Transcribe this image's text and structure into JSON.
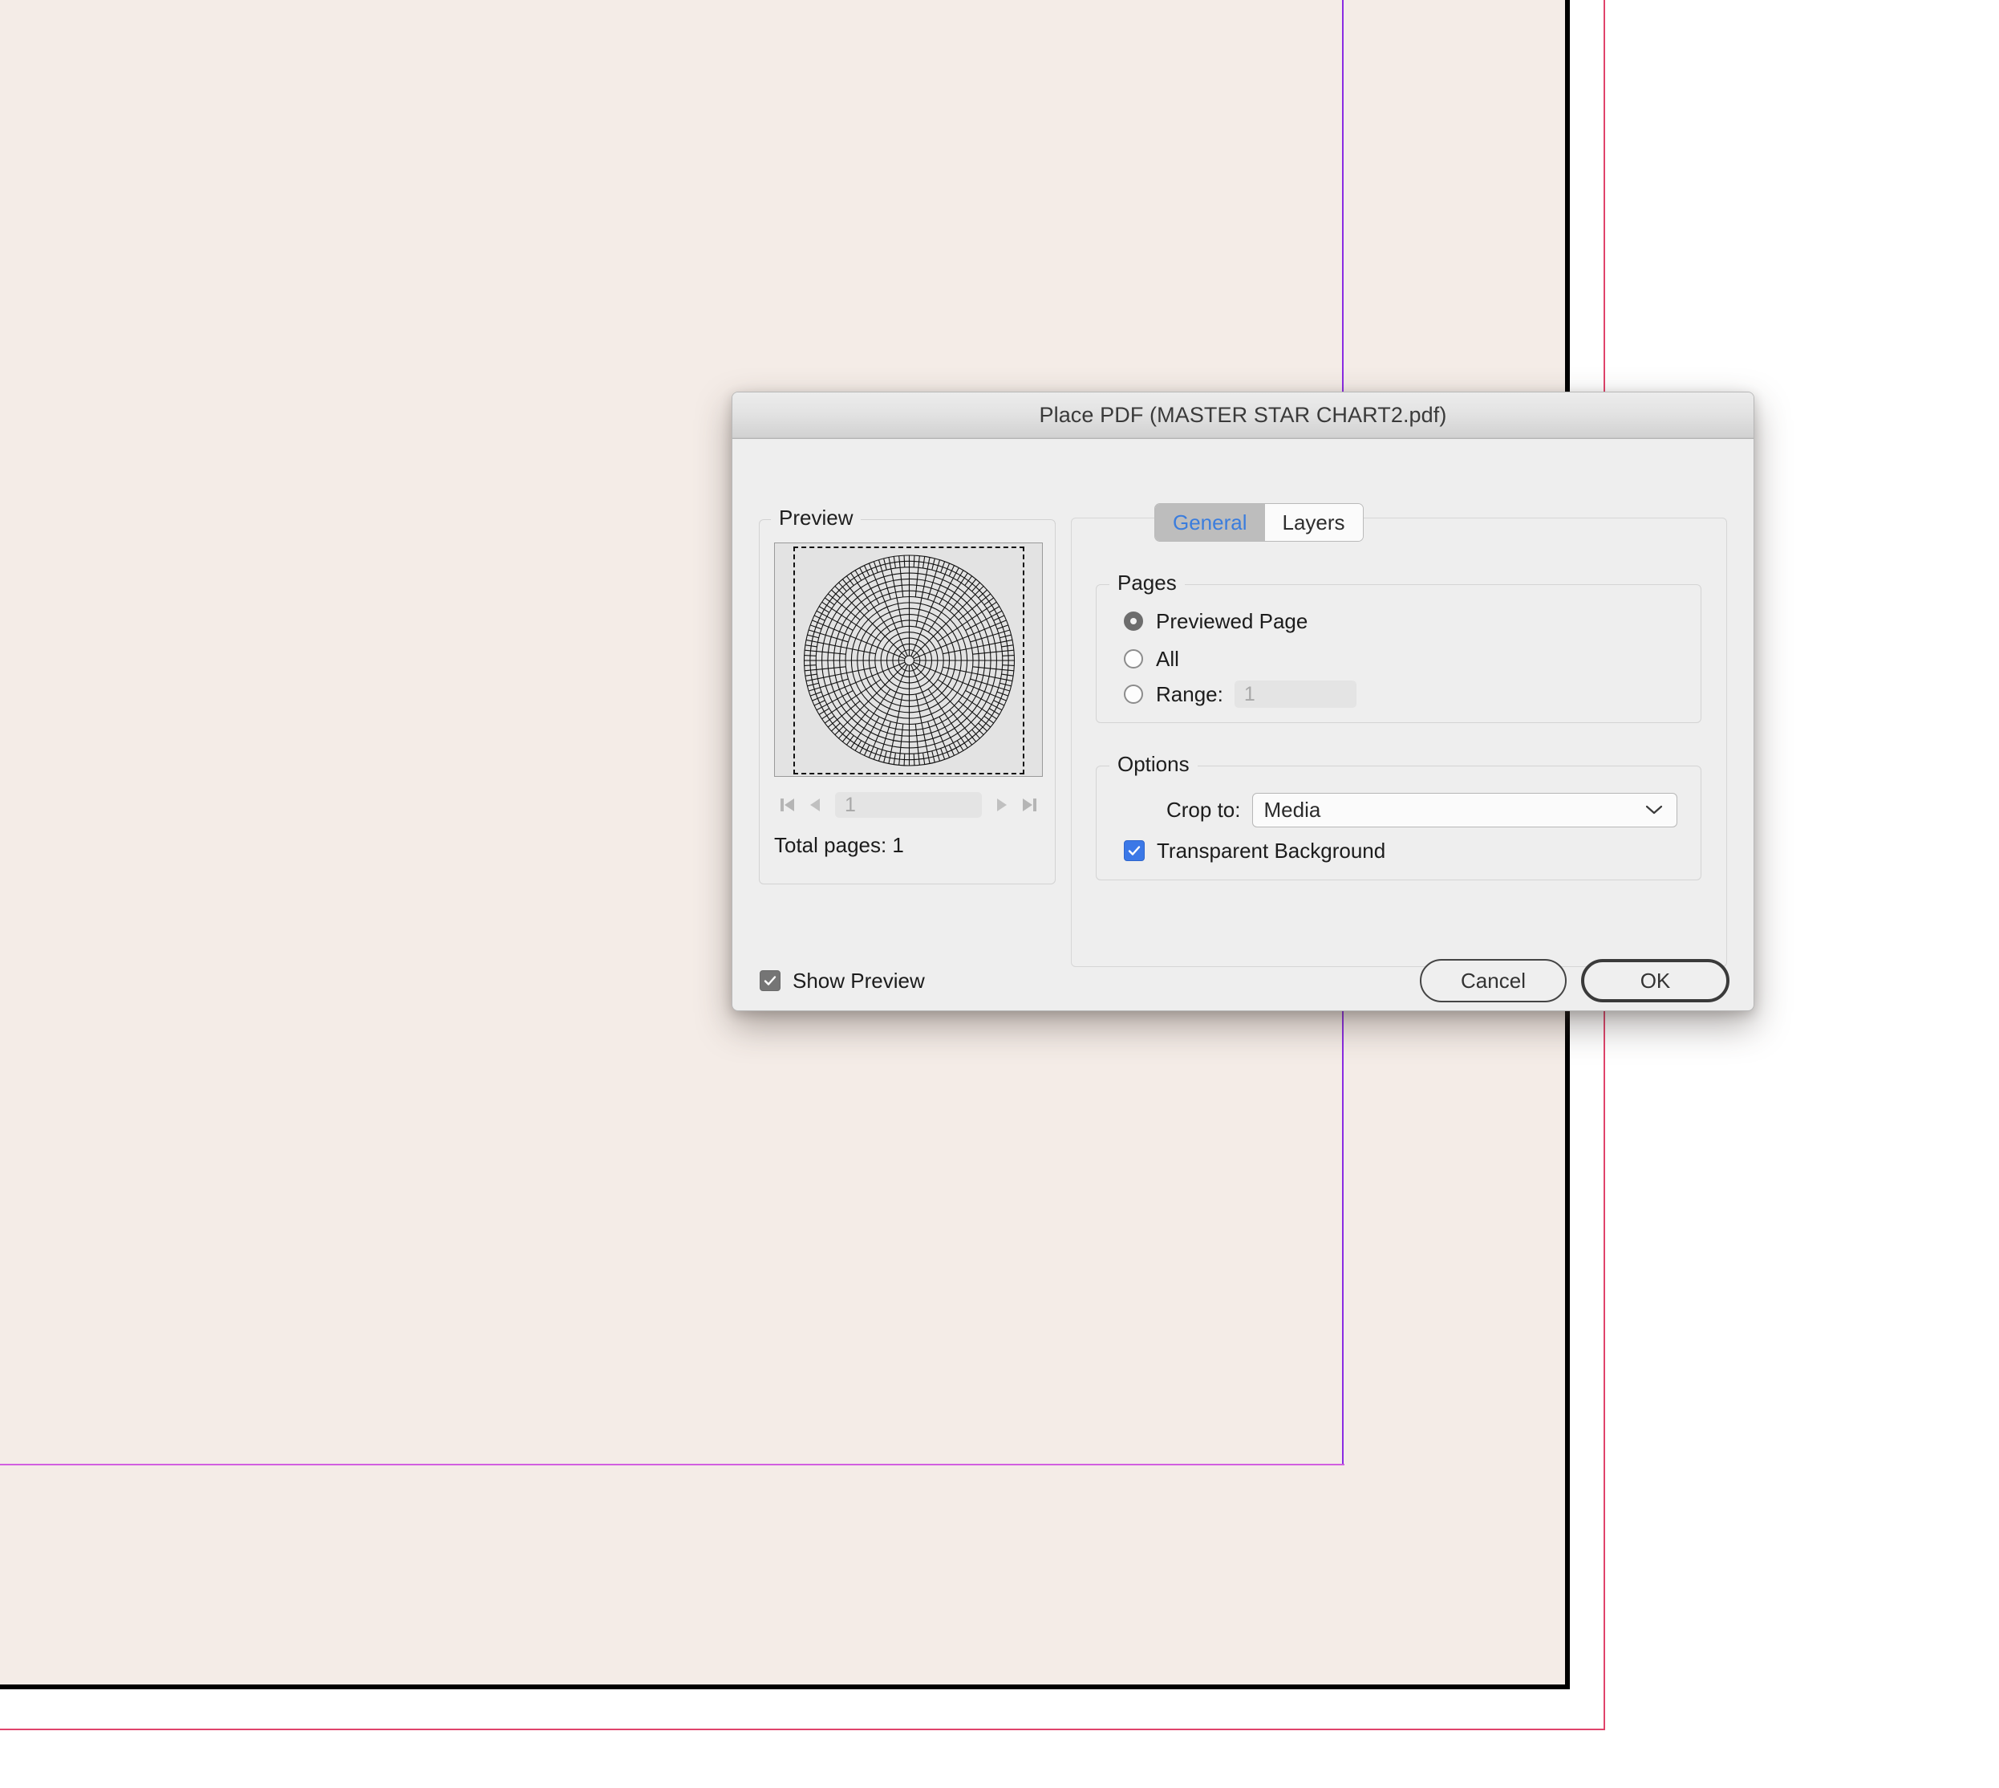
{
  "document": {
    "canvas_bg": "#f4ece7",
    "page_border_color": "#000000",
    "bleed_guide_color": "#e0436b",
    "margin_guide_color": "#8a2be2",
    "desktop_bg": "#ffffff"
  },
  "dialog": {
    "title": "Place PDF (MASTER STAR CHART2.pdf)",
    "tabs": [
      {
        "label": "General",
        "selected": true
      },
      {
        "label": "Layers",
        "selected": false
      }
    ],
    "accent_blue": "#3b7ddd",
    "preview": {
      "legend": "Preview",
      "page_value": "1",
      "total_pages": "Total pages: 1",
      "nav": {
        "first": "first-page",
        "prev": "previous-page",
        "next": "next-page",
        "last": "last-page"
      }
    },
    "pages": {
      "legend": "Pages",
      "options": [
        {
          "label": "Previewed Page",
          "selected": true
        },
        {
          "label": "All",
          "selected": false
        },
        {
          "label": "Range:",
          "selected": false
        }
      ],
      "range_value": "1"
    },
    "options": {
      "legend": "Options",
      "crop_label": "Crop to:",
      "crop_value": "Media",
      "crop_choices": [
        "Media"
      ],
      "transparent_background": {
        "label": "Transparent Background",
        "checked": true,
        "color": "#3b78e7"
      }
    },
    "footer": {
      "show_preview": {
        "label": "Show Preview",
        "checked": true,
        "color": "#757575"
      },
      "cancel_label": "Cancel",
      "ok_label": "OK"
    }
  },
  "chart_data": {
    "type": "polar-grid",
    "title": "MASTER STAR CHART2",
    "description": "Circular polar star chart: concentric rings crossed by radial spokes that subdivide outward",
    "rings": 17,
    "inner_hole_radius_fraction": 0.045,
    "spoke_counts_by_band": [
      16,
      32,
      64,
      128
    ],
    "stroke_color": "#111111",
    "background": "#e3e3e3"
  }
}
